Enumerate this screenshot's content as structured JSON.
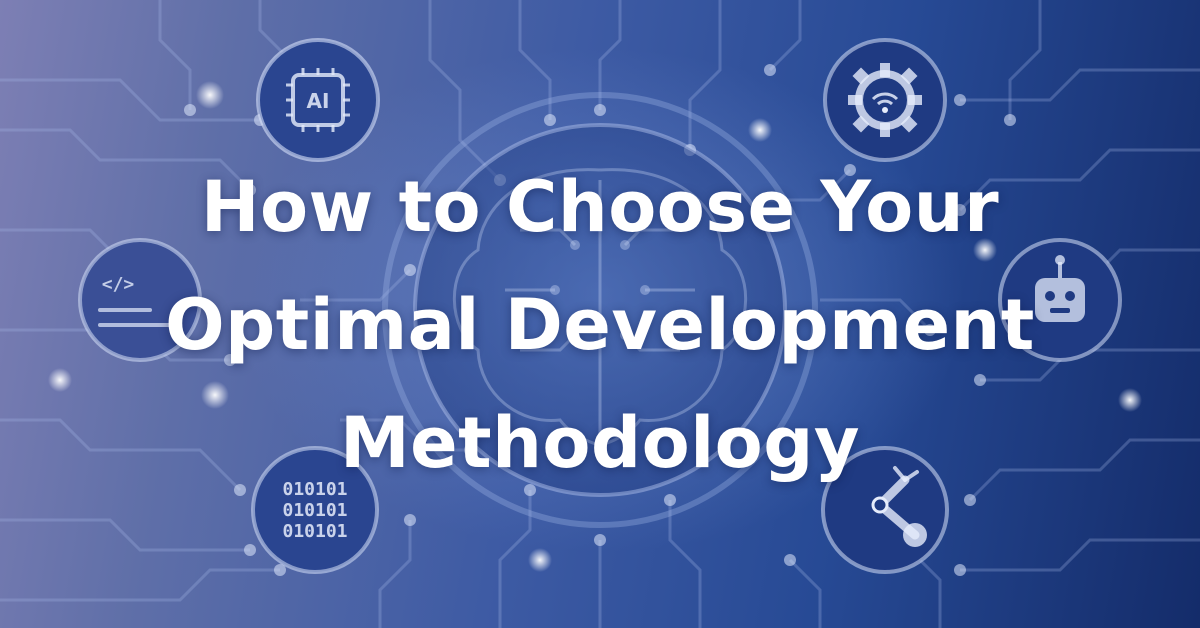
{
  "banner": {
    "title_lines": [
      "How to Choose Your",
      "Optimal Development",
      "Methodology"
    ],
    "icon_labels": {
      "ai_chip": "AI",
      "code": "</>",
      "binary": [
        "010101",
        "010101",
        "010101"
      ]
    },
    "icons": [
      "ai-chip-icon",
      "code-icon",
      "binary-icon",
      "gear-wifi-icon",
      "robot-icon",
      "robotic-arm-icon",
      "brain-icon"
    ],
    "colors": {
      "text": "#ffffff",
      "accent": "#ffffff",
      "background_dark": "#142c6a",
      "background_light": "#7d7fb4"
    }
  }
}
